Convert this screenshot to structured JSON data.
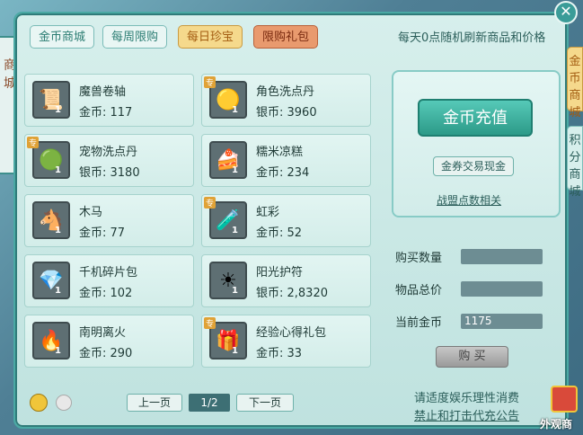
{
  "left_strip": {
    "chars": "商城"
  },
  "tabs": [
    {
      "label": "金币商城",
      "state": "normal"
    },
    {
      "label": "每周限购",
      "state": "normal"
    },
    {
      "label": "每日珍宝",
      "state": "active"
    },
    {
      "label": "限购礼包",
      "state": "red"
    }
  ],
  "refresh_note": "每天0点随机刷新商品和价格",
  "items": [
    {
      "name": "魔兽卷轴",
      "price": "金币: 117",
      "qty": "1",
      "icon": "scroll-icon",
      "special": ""
    },
    {
      "name": "角色洗点丹",
      "price": "银币: 3960",
      "qty": "1",
      "icon": "pill-icon",
      "special": "专"
    },
    {
      "name": "宠物洗点丹",
      "price": "银币: 3180",
      "qty": "1",
      "icon": "pill-icon",
      "special": "专"
    },
    {
      "name": "糯米凉糕",
      "price": "金币: 234",
      "qty": "1",
      "icon": "cake-icon",
      "special": ""
    },
    {
      "name": "木马",
      "price": "金币: 77",
      "qty": "1",
      "icon": "rocking-horse-icon",
      "special": ""
    },
    {
      "name": "虹彩",
      "price": "金币: 52",
      "qty": "1",
      "icon": "potion-icon",
      "special": "专"
    },
    {
      "name": "千机碎片包",
      "price": "金币: 102",
      "qty": "1",
      "icon": "crystal-bag-icon",
      "special": ""
    },
    {
      "name": "阳光护符",
      "price": "银币: 2,8320",
      "qty": "1",
      "icon": "amulet-icon",
      "special": ""
    },
    {
      "name": "南明离火",
      "price": "金币: 290",
      "qty": "1",
      "icon": "fire-ring-icon",
      "special": ""
    },
    {
      "name": "经验心得礼包",
      "price": "金币: 33",
      "qty": "1",
      "icon": "gift-bag-icon",
      "special": "专"
    }
  ],
  "right_panel": {
    "recharge": "金币充值",
    "voucher": "金券交易现金",
    "alliance": "战盟点数相关"
  },
  "purchase": {
    "qty_label": "购买数量",
    "qty_value": "",
    "total_label": "物品总价",
    "total_value": "",
    "gold_label": "当前金币",
    "gold_value": "1175",
    "buy": "购 买"
  },
  "pager": {
    "prev": "上一页",
    "page": "1/2",
    "next": "下一页"
  },
  "notice": {
    "line1": "请适度娱乐理性消费",
    "line2": "禁止和打击代充公告"
  },
  "side_tabs": [
    {
      "label": "金币商城",
      "state": "active"
    },
    {
      "label": "积分商城",
      "state": "normal"
    }
  ],
  "corner": {
    "label": "外观商"
  }
}
